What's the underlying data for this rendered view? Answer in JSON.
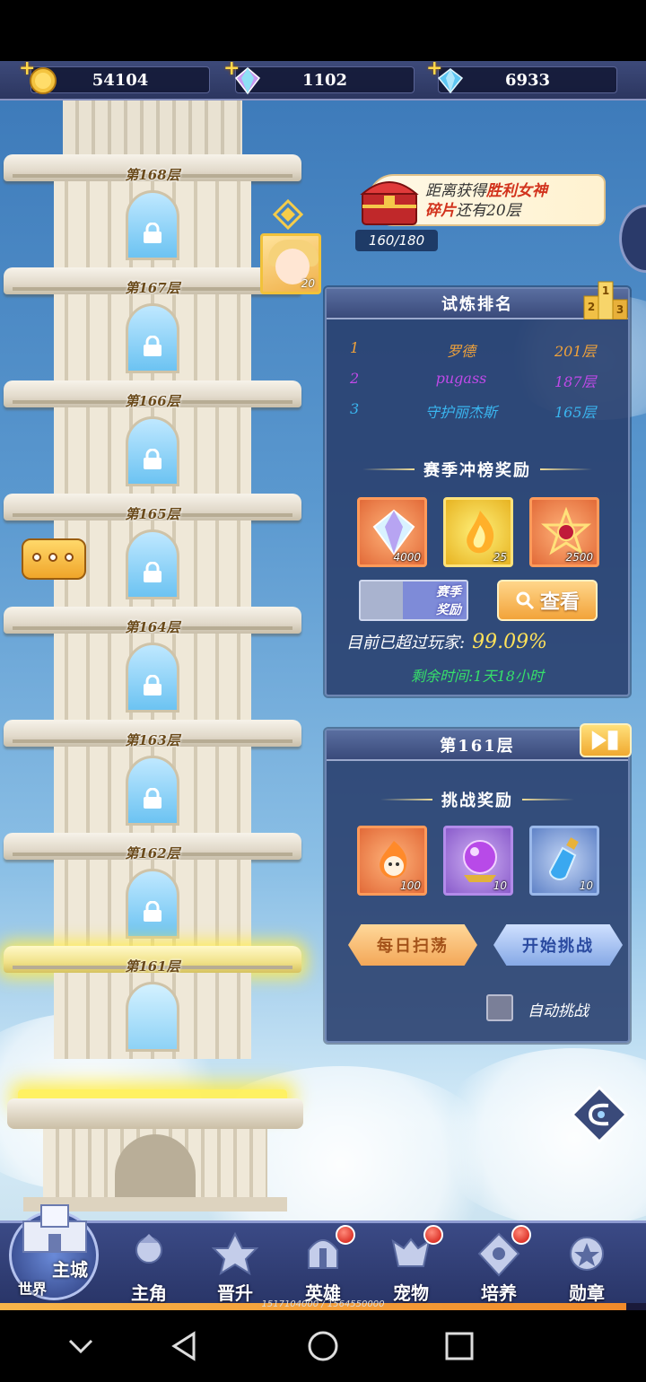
{
  "currency": {
    "gold": "54104",
    "rainbow_gem": "1102",
    "diamond": "6933",
    "plus": "+"
  },
  "tower": {
    "floors": [
      {
        "label": "第168层"
      },
      {
        "label": "第167层"
      },
      {
        "label": "第166层"
      },
      {
        "label": "第165层"
      },
      {
        "label": "第164层"
      },
      {
        "label": "第163层"
      },
      {
        "label": "第162层"
      },
      {
        "label": "第161层"
      }
    ],
    "player_level": "20"
  },
  "reward_banner": {
    "prefix": "距离获得",
    "highlight_1": "胜利女神",
    "highlight_2": "碎片",
    "suffix": "还有20层",
    "progress": "160/180"
  },
  "ranking": {
    "title": "试炼排名",
    "podium": {
      "first": "1",
      "second": "2",
      "third": "3"
    },
    "rows": [
      {
        "rank": "1",
        "name": "罗德",
        "floor": "201层",
        "color": "#f0a23a"
      },
      {
        "rank": "2",
        "name": "pugass",
        "floor": "187层",
        "color": "#c04ae8"
      },
      {
        "rank": "3",
        "name": "守护丽杰斯",
        "floor": "165层",
        "color": "#3ab6f0"
      }
    ],
    "season_title": "赛季冲榜奖励",
    "season_rewards": [
      {
        "icon": "crystal-icon",
        "count": "4000"
      },
      {
        "icon": "flame-spirit-icon",
        "count": "25"
      },
      {
        "icon": "star-gem-icon",
        "count": "2500"
      }
    ],
    "season_button": "赛季\n奖励",
    "view_button": "查看",
    "exceed_label": "目前已超过玩家:",
    "exceed_value": "99.09%",
    "remaining": "剩余时间:1天18小时"
  },
  "floor_panel": {
    "title": "第161层",
    "rewards_title": "挑战奖励",
    "rewards": [
      {
        "icon": "fire-skull-icon",
        "count": "100"
      },
      {
        "icon": "purple-orb-icon",
        "count": "10"
      },
      {
        "icon": "potion-icon",
        "count": "10"
      }
    ],
    "sweep_button": "每日扫荡",
    "start_button": "开始挑战",
    "auto_label": "自动挑战"
  },
  "nav": {
    "home_label": "主城",
    "world_label": "世界",
    "items": [
      {
        "label": "主角",
        "badge": false
      },
      {
        "label": "晋升",
        "badge": false
      },
      {
        "label": "英雄",
        "badge": true
      },
      {
        "label": "宠物",
        "badge": true
      },
      {
        "label": "培养",
        "badge": true
      },
      {
        "label": "勋章",
        "badge": false
      }
    ],
    "exp": "1517104000 / 1564550000",
    "exp_fraction": 0.97
  }
}
